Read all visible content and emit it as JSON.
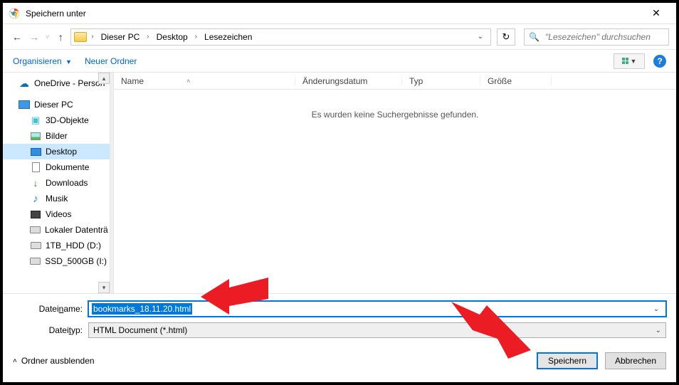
{
  "title": "Speichern unter",
  "breadcrumbs": [
    "Dieser PC",
    "Desktop",
    "Lesezeichen"
  ],
  "search_placeholder": "\"Lesezeichen\" durchsuchen",
  "toolbar": {
    "organize": "Organisieren",
    "new_folder": "Neuer Ordner"
  },
  "tree": {
    "items": [
      {
        "label": "OneDrive - Person",
        "icon": "onedrive"
      },
      {
        "label": "Dieser PC",
        "icon": "pc"
      },
      {
        "label": "3D-Objekte",
        "icon": "3d",
        "indent": true
      },
      {
        "label": "Bilder",
        "icon": "pic",
        "indent": true
      },
      {
        "label": "Desktop",
        "icon": "desktop",
        "indent": true,
        "selected": true
      },
      {
        "label": "Dokumente",
        "icon": "doc",
        "indent": true
      },
      {
        "label": "Downloads",
        "icon": "down",
        "indent": true
      },
      {
        "label": "Musik",
        "icon": "music",
        "indent": true
      },
      {
        "label": "Videos",
        "icon": "video",
        "indent": true
      },
      {
        "label": "Lokaler Datenträ",
        "icon": "disk",
        "indent": true
      },
      {
        "label": "1TB_HDD (D:)",
        "icon": "disk",
        "indent": true
      },
      {
        "label": "SSD_500GB (I:)",
        "icon": "disk",
        "indent": true
      }
    ]
  },
  "columns": {
    "name": "Name",
    "date": "Änderungsdatum",
    "type": "Typ",
    "size": "Größe"
  },
  "empty_message": "Es wurden keine Suchergebnisse gefunden.",
  "filename_label_pre": "Datei",
  "filename_label_u": "n",
  "filename_label_post": "ame:",
  "filename_value": "bookmarks_18.11.20.html",
  "filetype_label_pre": "Datei",
  "filetype_label_u": "t",
  "filetype_label_post": "yp:",
  "filetype_value": "HTML Document (*.html)",
  "hide_folders": "Ordner ausblenden",
  "buttons": {
    "save": "Speichern",
    "cancel": "Abbrechen"
  }
}
